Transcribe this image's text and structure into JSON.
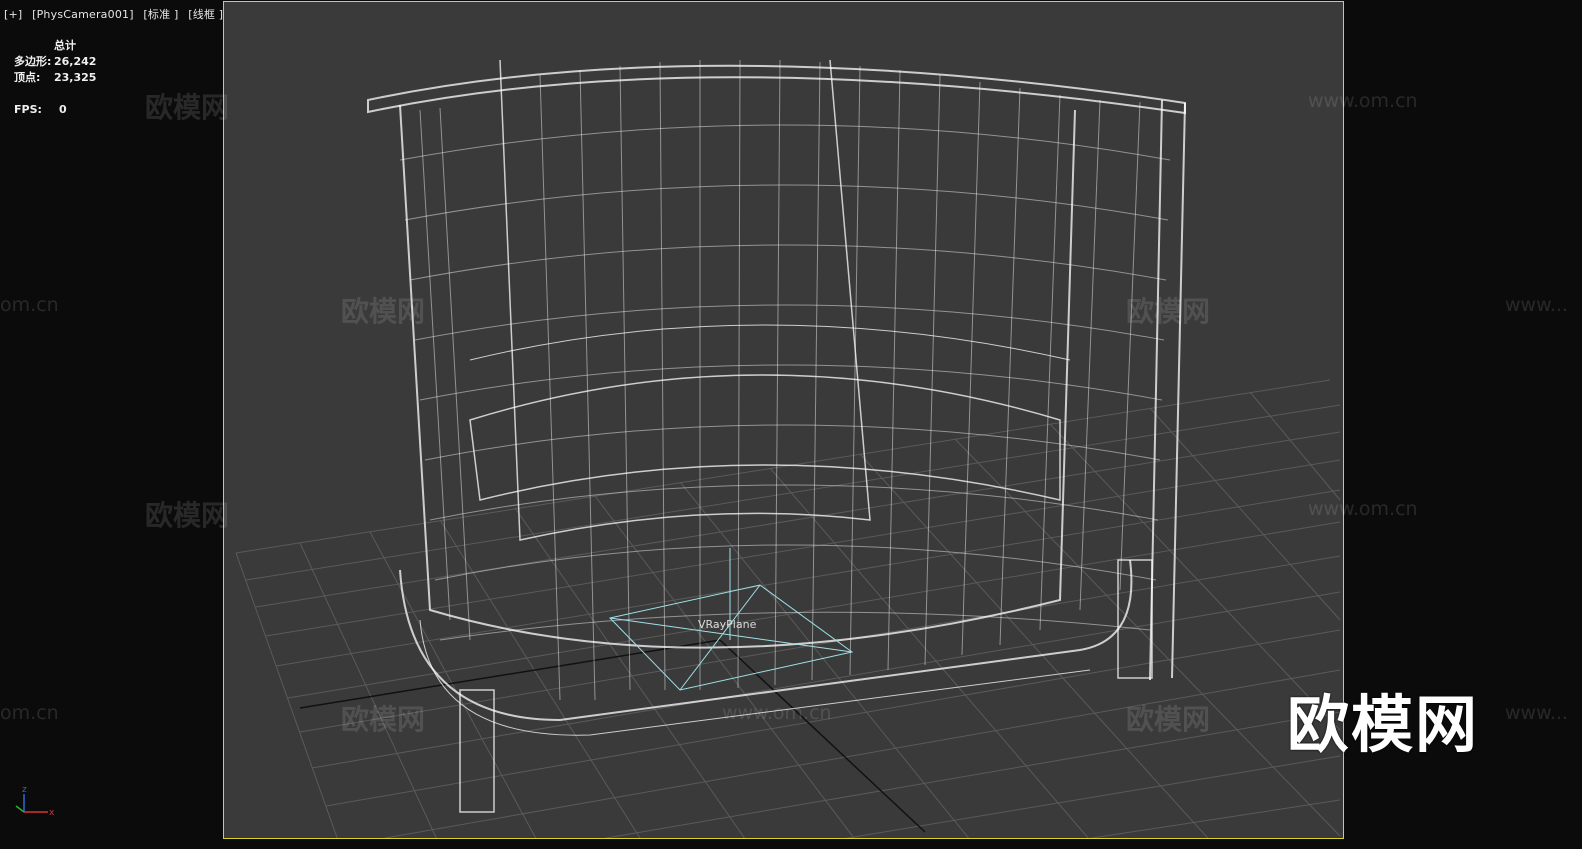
{
  "viewport": {
    "label_plus": "[+]",
    "label_camera": "[PhysCamera001]",
    "label_shading": "[标准 ]",
    "label_mode": "[线框 ]"
  },
  "stats": {
    "header": "总计",
    "polys_label": "多边形:",
    "polys_value": "26,242",
    "verts_label": "顶点:",
    "verts_value": "23,325",
    "fps_label": "FPS:",
    "fps_value": "0"
  },
  "scene": {
    "object_label": "VRayPlane",
    "axis_x": "x",
    "axis_z": "z"
  },
  "watermarks": {
    "cn": "欧模网",
    "url": "www.om.cn",
    "url_fragment": "om.cn",
    "url_prefix": "www..."
  },
  "logo": "欧模网",
  "colors": {
    "frame": "#d8d22a",
    "wire": "#ffffff",
    "gizmo": "#9fe0e8",
    "grid": "#555555"
  }
}
